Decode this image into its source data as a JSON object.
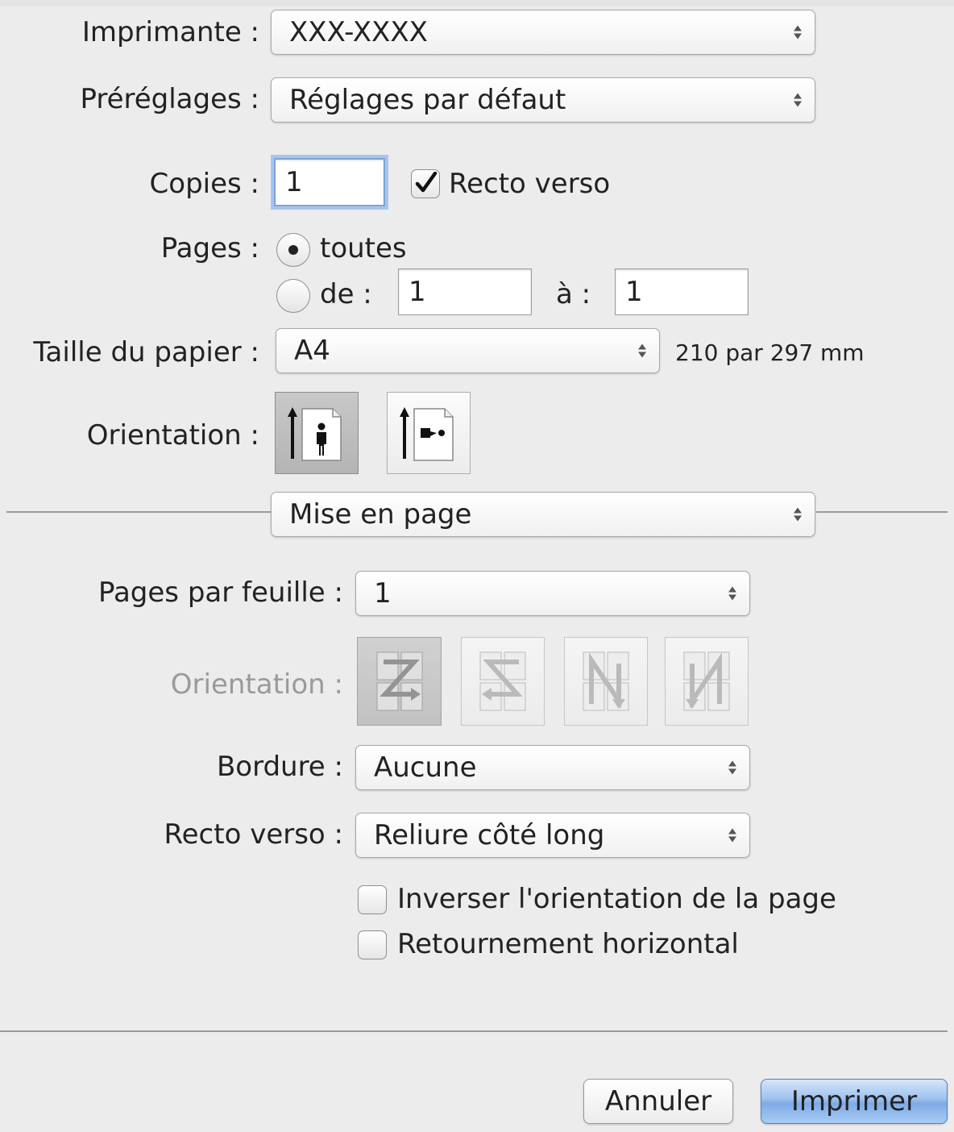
{
  "printer": {
    "label": "Imprimante :",
    "value": "XXX-XXXX"
  },
  "presets": {
    "label": "Préréglages :",
    "value": "Réglages par défaut"
  },
  "copies": {
    "label": "Copies :",
    "value": "1",
    "duplex_label": "Recto verso",
    "duplex_checked": true
  },
  "pages": {
    "label": "Pages :",
    "all_label": "toutes",
    "all_selected": true,
    "from_label": "de :",
    "from_value": "1",
    "to_label": "à :",
    "to_value": "1"
  },
  "paper_size": {
    "label": "Taille du papier :",
    "value": "A4",
    "dimensions": "210 par 297 mm"
  },
  "orientation": {
    "label": "Orientation :",
    "options": [
      "portrait-icon",
      "landscape-icon"
    ],
    "selected": "portrait"
  },
  "section": {
    "value": "Mise en page"
  },
  "layout": {
    "pages_per_sheet": {
      "label": "Pages par feuille :",
      "value": "1"
    },
    "direction": {
      "label": "Orientation :",
      "options": [
        "layout-z-icon",
        "layout-s-reverse-icon",
        "layout-n-reverse-icon",
        "layout-n-icon"
      ],
      "enabled": false
    },
    "border": {
      "label": "Bordure :",
      "value": "Aucune"
    },
    "two_sided": {
      "label": "Recto verso :",
      "value": "Reliure côté long"
    },
    "reverse_orientation": {
      "label": "Inverser l'orientation de la page",
      "checked": false
    },
    "flip_horizontal": {
      "label": "Retournement horizontal",
      "checked": false
    }
  },
  "buttons": {
    "cancel": "Annuler",
    "print": "Imprimer"
  },
  "colors": {
    "accent": "#7eaae6",
    "focus_ring": "#a7c4ec"
  }
}
